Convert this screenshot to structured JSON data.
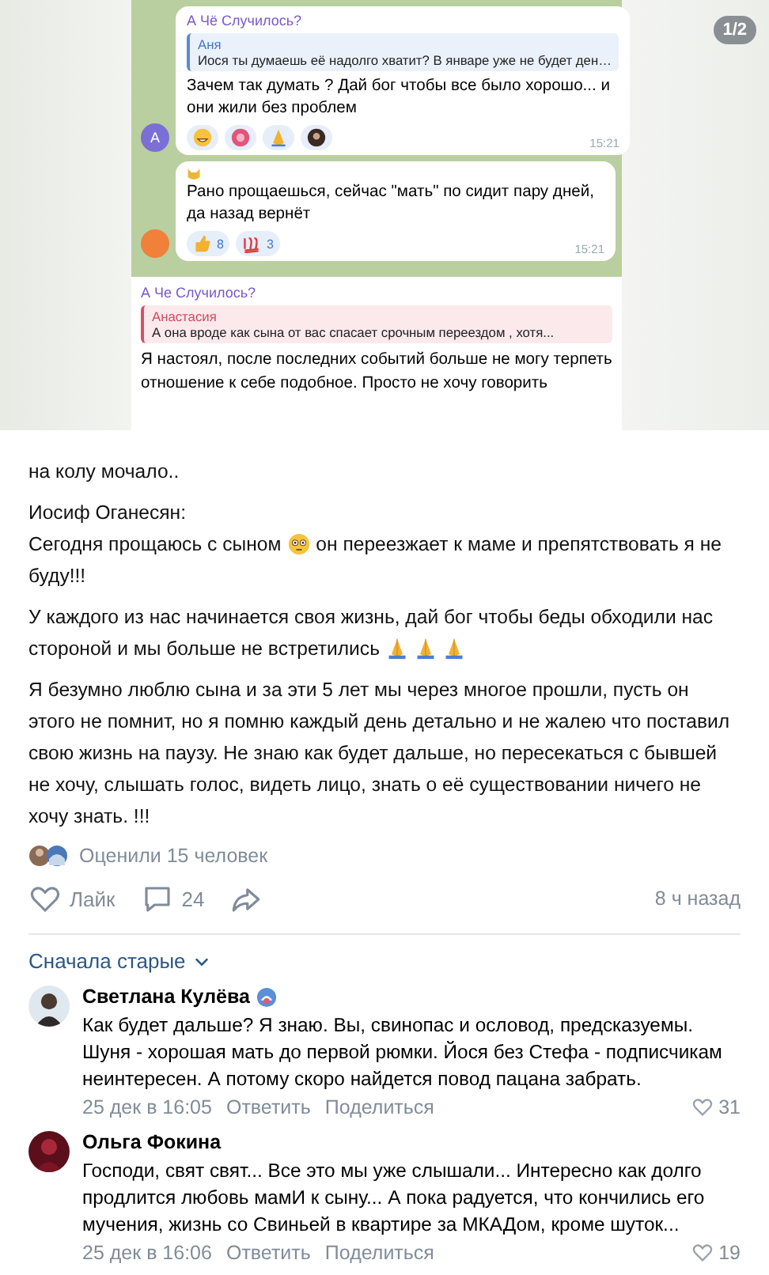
{
  "media": {
    "counter": "1/2",
    "messages": [
      {
        "kind": "bubble",
        "sender": "А Чё Случилось?",
        "quote": {
          "author": "Аня",
          "text": "Иося ты думаешь её надолго хватит? В январе уже не будет ден…"
        },
        "text": "Зачем так думать ? Дай бог чтобы все было хорошо... и они жили без проблем",
        "reactions": [
          {
            "kind": "emoji"
          },
          {
            "kind": "emoji"
          },
          {
            "kind": "emoji"
          },
          {
            "kind": "emoji"
          }
        ],
        "time": "15:21",
        "avatar": "А"
      },
      {
        "kind": "bubble",
        "text": "Рано прощаешься, сейчас \"мать\" по сидит пару дней, да назад вернёт",
        "reactions": [
          {
            "kind": "emoji",
            "count": "8"
          },
          {
            "kind": "emoji",
            "count": "3"
          }
        ],
        "time": "15:21"
      },
      {
        "kind": "plain",
        "sender": "А Че Случилось?",
        "quote": {
          "author": "Анастасия",
          "text": "А она вроде как сына от вас спасает срочным переездом , хотя..."
        },
        "text": "Я настоял, после последних событий больше не могу терпеть отношение к себе подобное. Просто не хочу говорить"
      }
    ]
  },
  "post": {
    "paragraphs": [
      {
        "text": "на колу мочало.."
      },
      {
        "lines": [
          [
            {
              "text": "Иосиф Оганесян:"
            }
          ],
          [
            {
              "text": "Сегодня прощаюсь с сыном"
            },
            {
              "kind": "emoji"
            },
            {
              "text": "он переезжает к маме и препятствовать я не"
            }
          ],
          [
            {
              "text": "буду!!!"
            }
          ]
        ]
      },
      {
        "lines": [
          [
            {
              "text": "У каждого из нас начинается своя жизнь, дай бог чтобы беды обходили нас"
            }
          ],
          [
            {
              "text": "стороной и мы больше не встретились"
            },
            {
              "kind": "emoji"
            },
            {
              "kind": "emoji"
            },
            {
              "kind": "emoji"
            }
          ]
        ]
      },
      {
        "text": "Я безумно люблю сына и за эти 5 лет мы через многое прошли, пусть он этого не помнит, но я помню каждый день детально и не жалею что поставил свою жизнь на паузу. Не знаю как будет дальше, но пересекаться с бывшей не хочу, слышать голос, видеть лицо, знать о её существовании ничего не хочу знать. !!!"
      }
    ],
    "rated": "Оценили 15 человек",
    "like": "Лайк",
    "liked": false,
    "comments": "24",
    "time": "8 ч назад"
  },
  "sort": "Сначала старые",
  "comments": [
    {
      "name": "Светлана Кулёва",
      "badge": true,
      "text": "Как будет дальше? Я знаю. Вы, свинопас и ословод, предсказуемы. Шуня - хорошая мать до первой рюмки. Йося без Стефа - подписчикам неинтересен. А потому скоро найдется повод пацана забрать.",
      "date": "25 дек в 16:05",
      "reply": "Ответить",
      "share": "Поделиться",
      "likes": "31"
    },
    {
      "name": "Ольга Фокина",
      "badge": false,
      "text": "Господи, свят свят... Все это мы уже слышали... Интересно как долго продлится любовь мамИ к сыну... А пока радуется, что кончились его мучения, жизнь со Свиньей в квартире за МКАДом, кроме шуток...",
      "date": "25 дек в 16:06",
      "reply": "Ответить",
      "share": "Поделиться",
      "likes": "19"
    }
  ]
}
